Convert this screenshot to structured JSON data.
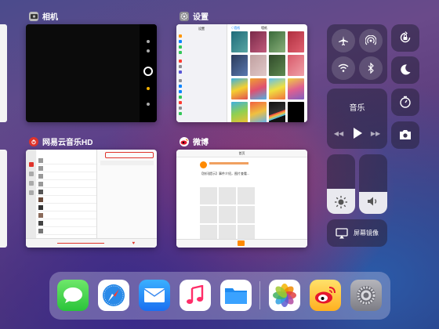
{
  "app_switcher": {
    "apps": [
      {
        "label": "相机"
      },
      {
        "label": "设置"
      },
      {
        "label": "网易云音乐HD"
      },
      {
        "label": "微博"
      }
    ],
    "settings_preview": {
      "left_title": "设置",
      "right_title": "墙纸",
      "back": "〈 墙纸"
    },
    "weibo_preview": {
      "title": "首页",
      "post": "【快讯提示】事件介绍，图片查看..."
    }
  },
  "control_center": {
    "music_title": "音乐",
    "screen_mirroring_label": "屏幕镜像",
    "brightness_level": 0.42,
    "volume_level": 0.37
  },
  "dock": {
    "apps": [
      "messages-icon",
      "safari-icon",
      "mail-icon",
      "music-icon",
      "files-icon",
      "photos-icon",
      "weibo-icon",
      "settings-icon"
    ]
  },
  "colors": {
    "accent_orange": "#ff8a00",
    "airplane_orange": "#ff9500",
    "bluetooth_blue": "#0a84ff",
    "netease_red": "#e0342b"
  }
}
